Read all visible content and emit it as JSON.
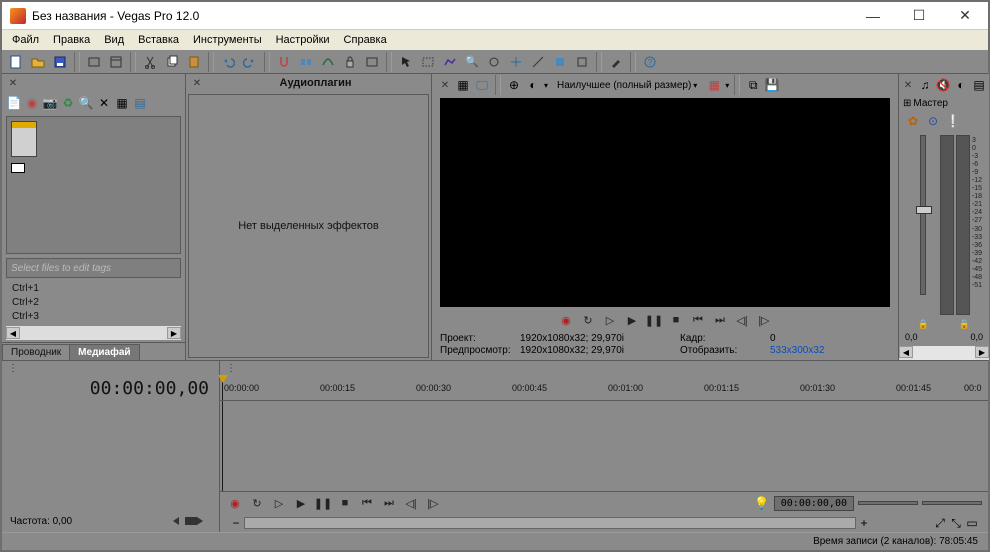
{
  "window": {
    "title": "Без названия - Vegas Pro 12.0"
  },
  "menu": {
    "items": [
      "Файл",
      "Правка",
      "Вид",
      "Вставка",
      "Инструменты",
      "Настройки",
      "Справка"
    ]
  },
  "media": {
    "tag_placeholder": "Select files to edit tags",
    "shortcuts": [
      "Ctrl+1",
      "Ctrl+2",
      "Ctrl+3"
    ],
    "tabs": {
      "explorer": "Проводник",
      "media": "Медиафай"
    }
  },
  "fx": {
    "title": "Аудиоплагин",
    "empty": "Нет выделенных эффектов"
  },
  "preview": {
    "quality": "Наилучшее (полный размер)",
    "info": {
      "project_lbl": "Проект:",
      "project_val": "1920x1080x32; 29,970i",
      "preview_lbl": "Предпросмотр:",
      "preview_val": "1920x1080x32; 29,970i",
      "frame_lbl": "Кадр:",
      "frame_val": "0",
      "display_lbl": "Отобразить:",
      "display_val": "533x300x32"
    }
  },
  "master": {
    "label": "Мастер",
    "ticks": [
      "3",
      "0",
      "-3",
      "-6",
      "-9",
      "-12",
      "-15",
      "-18",
      "-21",
      "-24",
      "-27",
      "-30",
      "-33",
      "-36",
      "-39",
      "-42",
      "-45",
      "-48",
      "-51"
    ],
    "foot_l": "0,0",
    "foot_r": "0,0"
  },
  "timeline": {
    "timecode": "00:00:00,00",
    "marks": [
      "00:00:00",
      "00:00:15",
      "00:00:30",
      "00:00:45",
      "00:01:00",
      "00:01:15",
      "00:01:30",
      "00:01:45",
      "00:0"
    ],
    "rate_lbl": "Частота: 0,00",
    "pos": "00:00:00,00"
  },
  "status": {
    "record": "Время записи (2 каналов): 78:05:45"
  }
}
